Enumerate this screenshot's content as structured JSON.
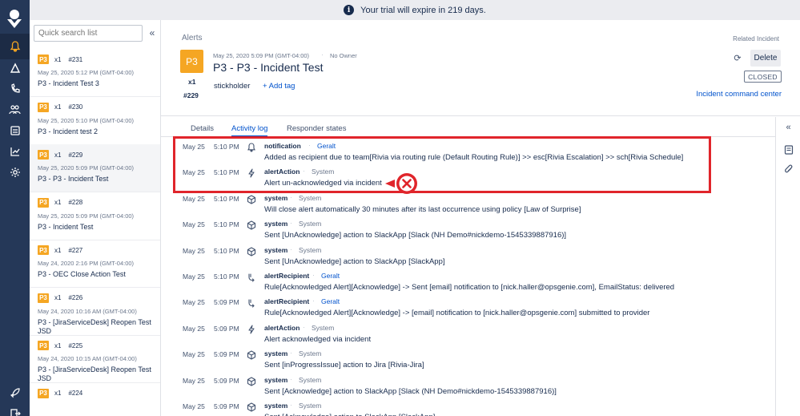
{
  "banner": {
    "text": "Your trial will expire in 219 days."
  },
  "nav": {
    "items": [
      "logo-icon",
      "alerts-icon",
      "incidents-icon",
      "oncall-icon",
      "teams-icon",
      "services-icon",
      "analytics-icon",
      "settings-icon",
      "rocket-icon",
      "logout-icon"
    ]
  },
  "list": {
    "search_placeholder": "Quick search list",
    "items": [
      {
        "priority": "P3",
        "count": "x1",
        "num": "#231",
        "date": "May 25, 2020 5:12 PM (GMT-04:00)",
        "title": "P3 - Incident Test 3"
      },
      {
        "priority": "P3",
        "count": "x1",
        "num": "#230",
        "date": "May 25, 2020 5:10 PM (GMT-04:00)",
        "title": "P3 - Incident test 2"
      },
      {
        "priority": "P3",
        "count": "x1",
        "num": "#229",
        "date": "May 25, 2020 5:09 PM (GMT-04:00)",
        "title": "P3 - P3 - Incident Test"
      },
      {
        "priority": "P3",
        "count": "x1",
        "num": "#228",
        "date": "May 25, 2020 5:09 PM (GMT-04:00)",
        "title": "P3 - Incident Test"
      },
      {
        "priority": "P3",
        "count": "x1",
        "num": "#227",
        "date": "May 24, 2020 2:16 PM (GMT-04:00)",
        "title": "P3 - OEC Close Action Test"
      },
      {
        "priority": "P3",
        "count": "x1",
        "num": "#226",
        "date": "May 24, 2020 10:16 AM (GMT-04:00)",
        "title": "P3 - [JiraServiceDesk] Reopen Test JSD"
      },
      {
        "priority": "P3",
        "count": "x1",
        "num": "#225",
        "date": "May 24, 2020 10:15 AM (GMT-04:00)",
        "title": "P3 - [JiraServiceDesk] Reopen Test JSD"
      },
      {
        "priority": "P3",
        "count": "x1",
        "num": "#224",
        "date": "",
        "title": ""
      }
    ]
  },
  "header": {
    "breadcrumb": "Alerts",
    "priority": "P3",
    "count": "x1",
    "num": "#229",
    "date": "May 25, 2020 5:09 PM (GMT-04:00)",
    "owner": "No Owner",
    "title": "P3 - P3 - Incident Test",
    "tag": "stickholder",
    "add_tag": "+ Add tag",
    "related": "Related Incident",
    "delete": "Delete",
    "status": "CLOSED",
    "command_center": "Incident command center"
  },
  "tabs": [
    "Details",
    "Activity log",
    "Responder states"
  ],
  "log": [
    {
      "date": "May 25",
      "time": "5:10 PM",
      "icon": "bell-icon",
      "type": "notification",
      "actor": "Geralt",
      "actor_link": true,
      "message": "Added as recipient due to team[Rivia via routing rule (Default Routing Rule)] >> esc[Rivia Escalation] >> sch[Rivia Schedule]"
    },
    {
      "date": "May 25",
      "time": "5:10 PM",
      "icon": "bolt-icon",
      "type": "alertAction",
      "actor": "System",
      "actor_link": false,
      "message": "Alert un-acknowledged via incident"
    },
    {
      "date": "May 25",
      "time": "5:10 PM",
      "icon": "cube-icon",
      "type": "system",
      "actor": "System",
      "actor_link": false,
      "message": "Will close alert automatically 30 minutes after its last occurrence using policy [Law of Surprise]"
    },
    {
      "date": "May 25",
      "time": "5:10 PM",
      "icon": "cube-icon",
      "type": "system",
      "actor": "System",
      "actor_link": false,
      "message": "Sent [UnAcknowledge] action to SlackApp [Slack (NH Demo#nickdemo-1545339887916)]"
    },
    {
      "date": "May 25",
      "time": "5:10 PM",
      "icon": "cube-icon",
      "type": "system",
      "actor": "System",
      "actor_link": false,
      "message": "Sent [UnAcknowledge] action to SlackApp [SlackApp]"
    },
    {
      "date": "May 25",
      "time": "5:10 PM",
      "icon": "recipient-icon",
      "type": "alertRecipient",
      "actor": "Geralt",
      "actor_link": true,
      "message": "Rule[Acknowledged Alert][Acknowledge] -> Sent [email] notification to [nick.haller@opsgenie.com], EmailStatus: delivered"
    },
    {
      "date": "May 25",
      "time": "5:09 PM",
      "icon": "recipient-icon",
      "type": "alertRecipient",
      "actor": "Geralt",
      "actor_link": true,
      "message": "Rule[Acknowledged Alert][Acknowledge] -> [email] notification to [nick.haller@opsgenie.com] submitted to provider"
    },
    {
      "date": "May 25",
      "time": "5:09 PM",
      "icon": "bolt-icon",
      "type": "alertAction",
      "actor": "System",
      "actor_link": false,
      "message": "Alert acknowledged via incident"
    },
    {
      "date": "May 25",
      "time": "5:09 PM",
      "icon": "cube-icon",
      "type": "system",
      "actor": "System",
      "actor_link": false,
      "message": "Sent [inProgressIssue] action to Jira [Rivia-Jira]"
    },
    {
      "date": "May 25",
      "time": "5:09 PM",
      "icon": "cube-icon",
      "type": "system",
      "actor": "System",
      "actor_link": false,
      "message": "Sent [Acknowledge] action to SlackApp [Slack (NH Demo#nickdemo-1545339887916)]"
    },
    {
      "date": "May 25",
      "time": "5:09 PM",
      "icon": "cube-icon",
      "type": "system",
      "actor": "System",
      "actor_link": false,
      "message": "Sent [Acknowledge] action to SlackApp [SlackApp]"
    }
  ],
  "colors": {
    "priority_p3": "#f5a623",
    "link": "#0052cc",
    "nav_bg": "#253858",
    "highlight": "#e0252b"
  }
}
